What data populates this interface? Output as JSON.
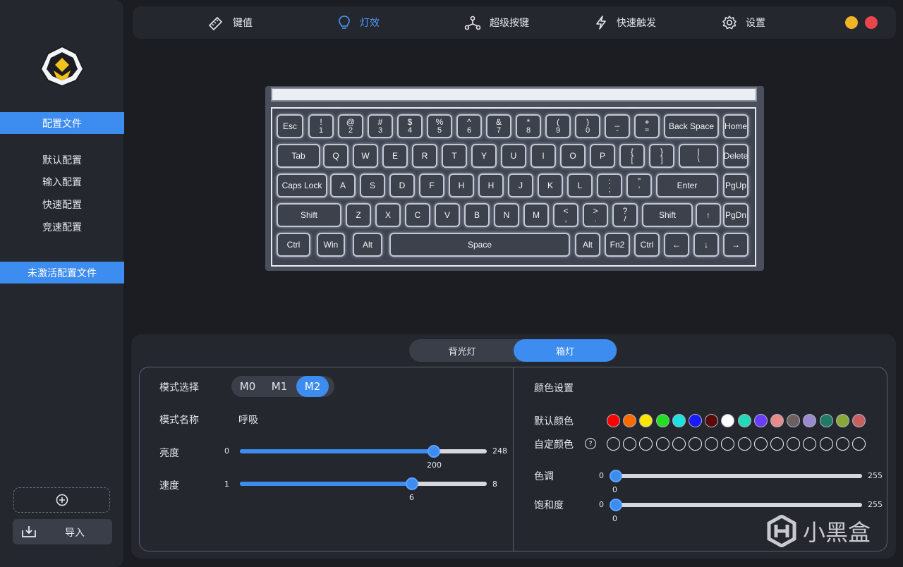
{
  "sidebar": {
    "profiles_header": "配置文件",
    "profiles": [
      "默认配置",
      "输入配置",
      "快速配置",
      "竞速配置"
    ],
    "inactive_header": "未激活配置文件",
    "import_label": "导入"
  },
  "nav": {
    "items": [
      {
        "label": "键值",
        "icon": "ruler-pen-icon"
      },
      {
        "label": "灯效",
        "icon": "lightbulb-icon"
      },
      {
        "label": "超级按键",
        "icon": "nodes-icon"
      },
      {
        "label": "快速触发",
        "icon": "lightning-icon"
      },
      {
        "label": "设置",
        "icon": "gear-icon"
      }
    ],
    "active": "灯效",
    "window_dots": [
      "#f0b429",
      "#e8464a"
    ]
  },
  "keyboard": {
    "rows": [
      [
        [
          "Esc",
          ""
        ],
        [
          "!",
          "1"
        ],
        [
          "@",
          "2"
        ],
        [
          "#",
          "3"
        ],
        [
          "$",
          "4"
        ],
        [
          "%",
          "5"
        ],
        [
          "^",
          "6"
        ],
        [
          "&",
          "7"
        ],
        [
          "*",
          "8"
        ],
        [
          "(",
          "9"
        ],
        [
          ")",
          "0"
        ],
        [
          "_",
          "-"
        ],
        [
          "+",
          "="
        ],
        [
          "Back Space",
          ""
        ],
        [
          "Home",
          ""
        ]
      ],
      [
        [
          "Tab",
          ""
        ],
        [
          "Q",
          ""
        ],
        [
          "W",
          ""
        ],
        [
          "E",
          ""
        ],
        [
          "R",
          ""
        ],
        [
          "T",
          ""
        ],
        [
          "Y",
          ""
        ],
        [
          "U",
          ""
        ],
        [
          "I",
          ""
        ],
        [
          "O",
          ""
        ],
        [
          "P",
          ""
        ],
        [
          "{",
          "["
        ],
        [
          "}",
          "]"
        ],
        [
          "|",
          "\\"
        ],
        [
          "Delete",
          ""
        ]
      ],
      [
        [
          "Caps Lock",
          ""
        ],
        [
          "A",
          ""
        ],
        [
          "S",
          ""
        ],
        [
          "D",
          ""
        ],
        [
          "F",
          ""
        ],
        [
          "H",
          ""
        ],
        [
          "H",
          ""
        ],
        [
          "J",
          ""
        ],
        [
          "K",
          ""
        ],
        [
          "L",
          ""
        ],
        [
          ":",
          ";"
        ],
        [
          "\"",
          "'"
        ],
        [
          "Enter",
          ""
        ],
        [
          "PgUp",
          ""
        ]
      ],
      [
        [
          "Shift",
          ""
        ],
        [
          "Z",
          ""
        ],
        [
          "X",
          ""
        ],
        [
          "C",
          ""
        ],
        [
          "V",
          ""
        ],
        [
          "B",
          ""
        ],
        [
          "N",
          ""
        ],
        [
          "M",
          ""
        ],
        [
          "<",
          ","
        ],
        [
          ">",
          "."
        ],
        [
          "?",
          "/"
        ],
        [
          "Shift",
          ""
        ],
        [
          "↑",
          ""
        ],
        [
          "PgDn",
          ""
        ]
      ],
      [
        [
          "Ctrl",
          ""
        ],
        [
          "Win",
          ""
        ],
        [
          "Alt",
          ""
        ],
        [
          "Space",
          ""
        ],
        [
          "Alt",
          ""
        ],
        [
          "Fn2",
          ""
        ],
        [
          "Ctrl",
          ""
        ],
        [
          "←",
          ""
        ],
        [
          "↓",
          ""
        ],
        [
          "→",
          ""
        ]
      ]
    ]
  },
  "panel": {
    "tabs": [
      "背光灯",
      "箱灯"
    ],
    "active_tab": "箱灯",
    "mode_label": "模式选择",
    "modes": [
      "M0",
      "M1",
      "M2"
    ],
    "active_mode": "M2",
    "mode_name_label": "模式名称",
    "mode_name": "呼吸",
    "brightness": {
      "label": "亮度",
      "min": "0",
      "max": "248",
      "value": "200"
    },
    "speed": {
      "label": "速度",
      "min": "1",
      "max": "8",
      "value": "6"
    },
    "color_settings_label": "颜色设置",
    "default_colors_label": "默认颜色",
    "default_colors": [
      "#ff0000",
      "#ff6a00",
      "#ffe600",
      "#22dd22",
      "#1de0e0",
      "#1a1aff",
      "#5a0a0a",
      "#ffffff",
      "#22d9b8",
      "#6a3cff",
      "#e88a8a",
      "#6a6060",
      "#9a8ad0",
      "#1f7a68",
      "#8aa83a",
      "#c86060"
    ],
    "custom_colors_label": "自定颜色",
    "custom_color_count": 16,
    "hue": {
      "label": "色调",
      "min": "0",
      "max": "255",
      "value": "0"
    },
    "saturation": {
      "label": "饱和度",
      "min": "0",
      "max": "255",
      "value": "0"
    }
  },
  "watermark": "小黑盒"
}
